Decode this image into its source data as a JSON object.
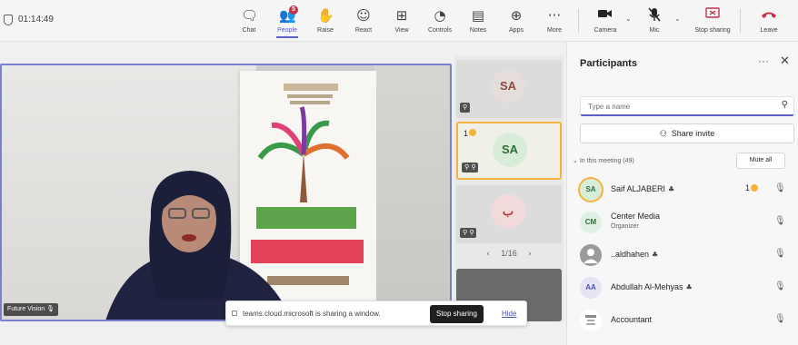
{
  "meeting": {
    "timer": "01:14:49"
  },
  "toolbar": {
    "items": [
      {
        "label": "Chat",
        "icon": "chat-icon",
        "glyph": "🗨"
      },
      {
        "label": "People",
        "icon": "people-icon",
        "glyph": "👥",
        "badge": "5"
      },
      {
        "label": "Raise",
        "icon": "raise-hand-icon",
        "glyph": "✋"
      },
      {
        "label": "React",
        "icon": "react-icon",
        "glyph": "☺"
      },
      {
        "label": "View",
        "icon": "view-icon",
        "glyph": "⊞"
      },
      {
        "label": "Controls",
        "icon": "controls-icon",
        "glyph": "◔"
      },
      {
        "label": "Notes",
        "icon": "notes-icon",
        "glyph": "▤"
      },
      {
        "label": "Apps",
        "icon": "apps-icon",
        "glyph": "⊕"
      },
      {
        "label": "More",
        "icon": "more-icon",
        "glyph": "···"
      }
    ],
    "camera_label": "Camera",
    "mic_label": "Mic",
    "share_label": "Stop sharing",
    "leave_label": "Leave",
    "leave_color": "#c4314b",
    "accent": "#5b5fc7"
  },
  "stage": {
    "speaker_name": "Future Vision"
  },
  "tiles": [
    {
      "initials": "SA",
      "bg": "#e5ddd9",
      "color": "#8a4b3f"
    },
    {
      "initials": "SA",
      "bg": "#d9ecd9",
      "color": "#2f6b3a",
      "raise": "1",
      "highlight": "#f2b43c"
    },
    {
      "initials": "ب",
      "bg": "#f3dada",
      "color": "#b03a3a"
    }
  ],
  "pager": {
    "prev": "‹",
    "text": "1/16",
    "next": "›"
  },
  "share_bar": {
    "text": "teams.cloud.microsoft is sharing a window.",
    "stop": "Stop sharing",
    "hide": "Hide"
  },
  "panel": {
    "title": "Participants",
    "more": "···",
    "close": "✕",
    "search_placeholder": "Type a name",
    "invite": "Share invite",
    "section": "In this meeting (49)",
    "mute_all": "Mute all"
  },
  "participants": [
    {
      "initials": "SA",
      "name": "Saif ALJABERI",
      "hand": "1",
      "bg": "#d9ecd9",
      "fg": "#2f6b3a",
      "ring": "#f2b43c"
    },
    {
      "initials": "CM",
      "name": "Center Media",
      "role": "Organizer",
      "bg": "#dff1e3",
      "fg": "#2f6b3a"
    },
    {
      "initials": "",
      "name": "..aldhahen",
      "bg": "#9a9a9a",
      "fg": "#ffffff"
    },
    {
      "initials": "AA",
      "name": "Abdullah Al-Mehyas",
      "bg": "#e6e3f5",
      "fg": "#4f52b2"
    },
    {
      "initials": "",
      "name": "Accountant",
      "bg": "#ffffff",
      "fg": "#444444"
    }
  ]
}
